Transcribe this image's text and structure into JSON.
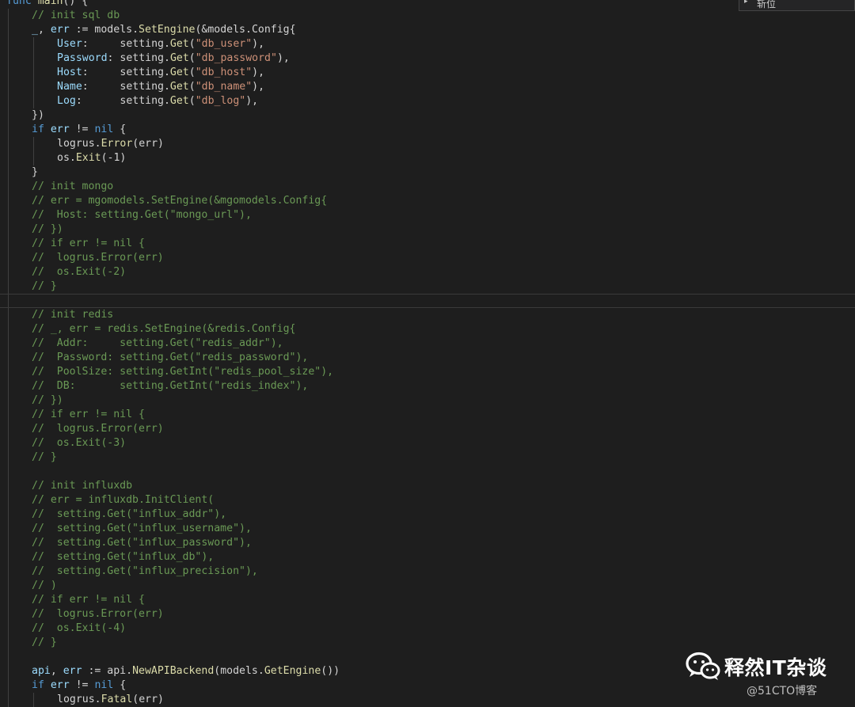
{
  "editor": {
    "lines": [
      {
        "indent": 0,
        "comment": false,
        "tokens": [
          [
            "kw",
            "func"
          ],
          [
            "txt",
            " "
          ],
          [
            "fn",
            "main"
          ],
          [
            "txt",
            "() {"
          ]
        ]
      },
      {
        "indent": 1,
        "comment": true,
        "tokens": [
          [
            "cmt",
            "// init sql db"
          ]
        ]
      },
      {
        "indent": 1,
        "comment": false,
        "tokens": [
          [
            "var",
            "_"
          ],
          [
            "txt",
            ", "
          ],
          [
            "var",
            "err"
          ],
          [
            "txt",
            " := models."
          ],
          [
            "fn",
            "SetEngine"
          ],
          [
            "txt",
            "(&models.Config{"
          ]
        ]
      },
      {
        "indent": 2,
        "comment": false,
        "tokens": [
          [
            "var",
            "User"
          ],
          [
            "txt",
            ":     setting."
          ],
          [
            "fn",
            "Get"
          ],
          [
            "txt",
            "("
          ],
          [
            "str",
            "\"db_user\""
          ],
          [
            "txt",
            "),"
          ]
        ]
      },
      {
        "indent": 2,
        "comment": false,
        "tokens": [
          [
            "var",
            "Password"
          ],
          [
            "txt",
            ": setting."
          ],
          [
            "fn",
            "Get"
          ],
          [
            "txt",
            "("
          ],
          [
            "str",
            "\"db_password\""
          ],
          [
            "txt",
            "),"
          ]
        ]
      },
      {
        "indent": 2,
        "comment": false,
        "tokens": [
          [
            "var",
            "Host"
          ],
          [
            "txt",
            ":     setting."
          ],
          [
            "fn",
            "Get"
          ],
          [
            "txt",
            "("
          ],
          [
            "str",
            "\"db_host\""
          ],
          [
            "txt",
            "),"
          ]
        ]
      },
      {
        "indent": 2,
        "comment": false,
        "tokens": [
          [
            "var",
            "Name"
          ],
          [
            "txt",
            ":     setting."
          ],
          [
            "fn",
            "Get"
          ],
          [
            "txt",
            "("
          ],
          [
            "str",
            "\"db_name\""
          ],
          [
            "txt",
            "),"
          ]
        ]
      },
      {
        "indent": 2,
        "comment": false,
        "tokens": [
          [
            "var",
            "Log"
          ],
          [
            "txt",
            ":      setting."
          ],
          [
            "fn",
            "Get"
          ],
          [
            "txt",
            "("
          ],
          [
            "str",
            "\"db_log\""
          ],
          [
            "txt",
            "),"
          ]
        ]
      },
      {
        "indent": 1,
        "comment": false,
        "tokens": [
          [
            "txt",
            "})"
          ]
        ]
      },
      {
        "indent": 1,
        "comment": false,
        "tokens": [
          [
            "kw",
            "if"
          ],
          [
            "txt",
            " "
          ],
          [
            "var",
            "err"
          ],
          [
            "txt",
            " != "
          ],
          [
            "kw",
            "nil"
          ],
          [
            "txt",
            " {"
          ]
        ]
      },
      {
        "indent": 2,
        "comment": false,
        "tokens": [
          [
            "txt",
            "logrus."
          ],
          [
            "fn",
            "Error"
          ],
          [
            "txt",
            "(err)"
          ]
        ]
      },
      {
        "indent": 2,
        "comment": false,
        "tokens": [
          [
            "txt",
            "os."
          ],
          [
            "fn",
            "Exit"
          ],
          [
            "txt",
            "(-1)"
          ]
        ]
      },
      {
        "indent": 1,
        "comment": false,
        "tokens": [
          [
            "txt",
            "}"
          ]
        ]
      },
      {
        "indent": 1,
        "comment": true,
        "tokens": [
          [
            "cmt",
            "// init mongo"
          ]
        ]
      },
      {
        "indent": 1,
        "comment": true,
        "tokens": [
          [
            "cmt",
            "// err = mgomodels.SetEngine(&mgomodels.Config{"
          ]
        ]
      },
      {
        "indent": 1,
        "comment": true,
        "tokens": [
          [
            "cmt",
            "//  Host: setting.Get(\"mongo_url\"),"
          ]
        ]
      },
      {
        "indent": 1,
        "comment": true,
        "tokens": [
          [
            "cmt",
            "// })"
          ]
        ]
      },
      {
        "indent": 1,
        "comment": true,
        "tokens": [
          [
            "cmt",
            "// if err != nil {"
          ]
        ]
      },
      {
        "indent": 1,
        "comment": true,
        "tokens": [
          [
            "cmt",
            "//  logrus.Error(err)"
          ]
        ]
      },
      {
        "indent": 1,
        "comment": true,
        "tokens": [
          [
            "cmt",
            "//  os.Exit(-2)"
          ]
        ]
      },
      {
        "indent": 1,
        "comment": true,
        "tokens": [
          [
            "cmt",
            "// }"
          ]
        ]
      },
      {
        "indent": 1,
        "comment": false,
        "current": true,
        "tokens": []
      },
      {
        "indent": 1,
        "comment": true,
        "tokens": [
          [
            "cmt",
            "// init redis"
          ]
        ]
      },
      {
        "indent": 1,
        "comment": true,
        "tokens": [
          [
            "cmt",
            "// _, err = redis.SetEngine(&redis.Config{"
          ]
        ]
      },
      {
        "indent": 1,
        "comment": true,
        "tokens": [
          [
            "cmt",
            "//  Addr:     setting.Get(\"redis_addr\"),"
          ]
        ]
      },
      {
        "indent": 1,
        "comment": true,
        "tokens": [
          [
            "cmt",
            "//  Password: setting.Get(\"redis_password\"),"
          ]
        ]
      },
      {
        "indent": 1,
        "comment": true,
        "tokens": [
          [
            "cmt",
            "//  PoolSize: setting.GetInt(\"redis_pool_size\"),"
          ]
        ]
      },
      {
        "indent": 1,
        "comment": true,
        "tokens": [
          [
            "cmt",
            "//  DB:       setting.GetInt(\"redis_index\"),"
          ]
        ]
      },
      {
        "indent": 1,
        "comment": true,
        "tokens": [
          [
            "cmt",
            "// })"
          ]
        ]
      },
      {
        "indent": 1,
        "comment": true,
        "tokens": [
          [
            "cmt",
            "// if err != nil {"
          ]
        ]
      },
      {
        "indent": 1,
        "comment": true,
        "tokens": [
          [
            "cmt",
            "//  logrus.Error(err)"
          ]
        ]
      },
      {
        "indent": 1,
        "comment": true,
        "tokens": [
          [
            "cmt",
            "//  os.Exit(-3)"
          ]
        ]
      },
      {
        "indent": 1,
        "comment": true,
        "tokens": [
          [
            "cmt",
            "// }"
          ]
        ]
      },
      {
        "indent": 1,
        "comment": false,
        "tokens": []
      },
      {
        "indent": 1,
        "comment": true,
        "tokens": [
          [
            "cmt",
            "// init influxdb"
          ]
        ]
      },
      {
        "indent": 1,
        "comment": true,
        "tokens": [
          [
            "cmt",
            "// err = influxdb.InitClient("
          ]
        ]
      },
      {
        "indent": 1,
        "comment": true,
        "tokens": [
          [
            "cmt",
            "//  setting.Get(\"influx_addr\"),"
          ]
        ]
      },
      {
        "indent": 1,
        "comment": true,
        "tokens": [
          [
            "cmt",
            "//  setting.Get(\"influx_username\"),"
          ]
        ]
      },
      {
        "indent": 1,
        "comment": true,
        "tokens": [
          [
            "cmt",
            "//  setting.Get(\"influx_password\"),"
          ]
        ]
      },
      {
        "indent": 1,
        "comment": true,
        "tokens": [
          [
            "cmt",
            "//  setting.Get(\"influx_db\"),"
          ]
        ]
      },
      {
        "indent": 1,
        "comment": true,
        "tokens": [
          [
            "cmt",
            "//  setting.Get(\"influx_precision\"),"
          ]
        ]
      },
      {
        "indent": 1,
        "comment": true,
        "tokens": [
          [
            "cmt",
            "// )"
          ]
        ]
      },
      {
        "indent": 1,
        "comment": true,
        "tokens": [
          [
            "cmt",
            "// if err != nil {"
          ]
        ]
      },
      {
        "indent": 1,
        "comment": true,
        "tokens": [
          [
            "cmt",
            "//  logrus.Error(err)"
          ]
        ]
      },
      {
        "indent": 1,
        "comment": true,
        "tokens": [
          [
            "cmt",
            "//  os.Exit(-4)"
          ]
        ]
      },
      {
        "indent": 1,
        "comment": true,
        "tokens": [
          [
            "cmt",
            "// }"
          ]
        ]
      },
      {
        "indent": 1,
        "comment": false,
        "tokens": []
      },
      {
        "indent": 1,
        "comment": false,
        "tokens": [
          [
            "var",
            "api"
          ],
          [
            "txt",
            ", "
          ],
          [
            "var",
            "err"
          ],
          [
            "txt",
            " := api."
          ],
          [
            "fn",
            "NewAPIBackend"
          ],
          [
            "txt",
            "(models."
          ],
          [
            "fn",
            "GetEngine"
          ],
          [
            "txt",
            "())"
          ]
        ]
      },
      {
        "indent": 1,
        "comment": false,
        "tokens": [
          [
            "kw",
            "if"
          ],
          [
            "txt",
            " "
          ],
          [
            "var",
            "err"
          ],
          [
            "txt",
            " != "
          ],
          [
            "kw",
            "nil"
          ],
          [
            "txt",
            " {"
          ]
        ]
      },
      {
        "indent": 2,
        "comment": false,
        "tokens": [
          [
            "txt",
            "logrus."
          ],
          [
            "fn",
            "Fatal"
          ],
          [
            "txt",
            "(err)"
          ]
        ]
      }
    ]
  },
  "overlay_widget": {
    "label": "斩位"
  },
  "watermark": {
    "account_name": "释然IT杂谈",
    "site_mark": "@51CTO博客",
    "logo_icon": "wechat-icon"
  },
  "colors": {
    "background": "#1e1e1e",
    "keyword": "#569cd6",
    "variable": "#9cdcfe",
    "function": "#dcdcaa",
    "string": "#ce9178",
    "comment": "#6a9955"
  }
}
